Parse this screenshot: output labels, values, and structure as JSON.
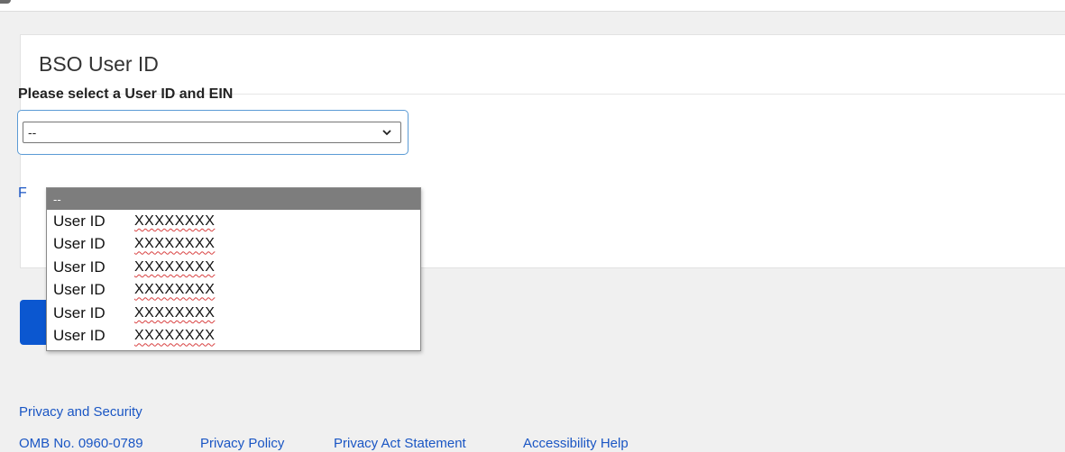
{
  "card": {
    "title": "BSO User ID",
    "field_label": "Please select a User ID and EIN",
    "selected_value": "--",
    "partial_link_text": "F"
  },
  "dropdown": {
    "placeholder_option": "--",
    "options": [
      {
        "label": "User ID",
        "value": "XXXXXXXX"
      },
      {
        "label": "User ID",
        "value": "XXXXXXXX"
      },
      {
        "label": "User ID",
        "value": "XXXXXXXX"
      },
      {
        "label": "User ID",
        "value": "XXXXXXXX"
      },
      {
        "label": "User ID",
        "value": "XXXXXXXX"
      },
      {
        "label": "User ID",
        "value": "XXXXXXXX"
      }
    ]
  },
  "footer": {
    "privacy_security": "Privacy and Security",
    "omb": "OMB No. 0960-0789",
    "privacy_policy": "Privacy Policy",
    "privacy_act": "Privacy Act Statement",
    "accessibility": "Accessibility Help"
  },
  "colors": {
    "link": "#1a56c4",
    "primary_button": "#0b57d0",
    "focus_ring": "#5b9bd5",
    "selected_option_bg": "#7d7d7d"
  }
}
